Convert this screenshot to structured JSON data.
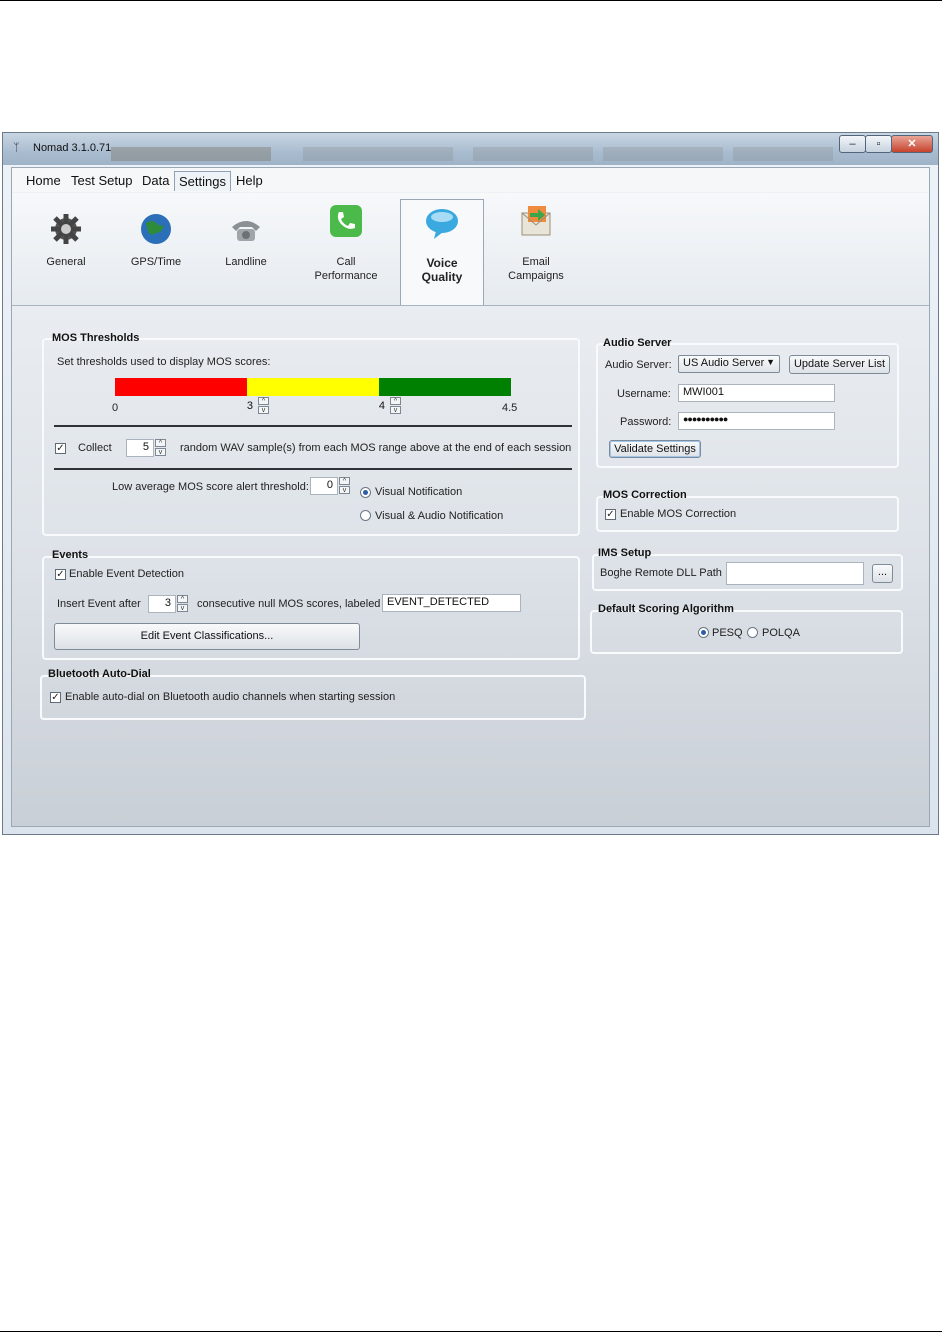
{
  "window": {
    "title": "Nomad 3.1.0.71",
    "minimize": "–",
    "maximize": "▫",
    "close": "✕",
    "app_icon": "antenna-icon"
  },
  "menu": [
    "Home",
    "Test Setup",
    "Data",
    "Settings",
    "Help"
  ],
  "menu_active": "Settings",
  "ribbon_tabs": [
    {
      "line1": "General",
      "line2": "",
      "icon": "gear-icon"
    },
    {
      "line1": "GPS/Time",
      "line2": "",
      "icon": "globe-icon"
    },
    {
      "line1": "Landline",
      "line2": "",
      "icon": "telephone-icon"
    },
    {
      "line1": "Call",
      "line2": "Performance",
      "icon": "phone-app-icon"
    },
    {
      "line1": "Voice",
      "line2": "Quality",
      "icon": "speech-bubble-icon"
    },
    {
      "line1": "Email",
      "line2": "Campaigns",
      "icon": "email-icon"
    }
  ],
  "ribbon_active": "Voice Quality",
  "mos_thresholds": {
    "title": "MOS Thresholds",
    "description": "Set thresholds used to display MOS scores:",
    "scale_min": "0",
    "threshold1": "3",
    "threshold2": "4",
    "scale_max": "4.5",
    "colors": {
      "low": "#ff0000",
      "mid": "#ffff00",
      "high": "#008000"
    },
    "collect_label": "Collect",
    "collect_value": "5",
    "collect_suffix": "random WAV sample(s) from each MOS range above at the end of each session",
    "collect_checked": true,
    "alert_label": "Low average MOS score alert threshold:",
    "alert_value": "0",
    "visual_label": "Visual Notification",
    "visual_audio_label": "Visual & Audio Notification",
    "selected_notification": "Visual Notification"
  },
  "events": {
    "title": "Events",
    "enable_label": "Enable Event Detection",
    "enable_checked": true,
    "insert_label": "Insert Event after",
    "insert_value": "3",
    "consecutive_label": "consecutive null MOS scores, labeled",
    "label_value": "EVENT_DETECTED",
    "edit_button": "Edit Event Classifications..."
  },
  "bluetooth": {
    "title": "Bluetooth Auto-Dial",
    "enable_label": "Enable auto-dial on Bluetooth audio channels when starting session",
    "enable_checked": true
  },
  "audio_server": {
    "title": "Audio Server",
    "server_label": "Audio Server:",
    "server_value": "US Audio Server",
    "update_button": "Update Server List",
    "username_label": "Username:",
    "username_value": "MWI001",
    "password_label": "Password:",
    "password_value": "●●●●●●●●●●",
    "validate_button": "Validate Settings"
  },
  "mos_correction": {
    "title": "MOS Correction",
    "enable_label": "Enable MOS Correction",
    "enable_checked": true
  },
  "ims_setup": {
    "title": "IMS Setup",
    "path_label": "Boghe Remote DLL Path",
    "path_value": "",
    "browse_button": "..."
  },
  "scoring": {
    "title": "Default Scoring Algorithm",
    "pesq_label": "PESQ",
    "polqa_label": "POLQA",
    "selected": "PESQ"
  }
}
